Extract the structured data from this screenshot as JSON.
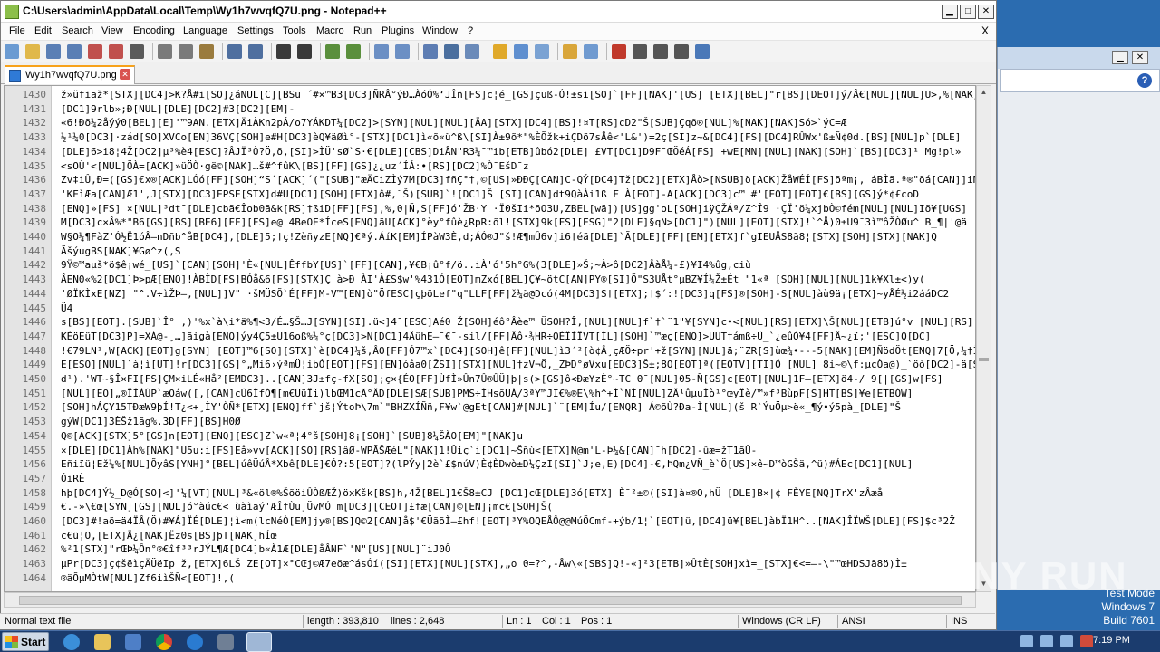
{
  "window": {
    "title": "C:\\Users\\admin\\AppData\\Local\\Temp\\Wy1h7wvqfQ7U.png - Notepad++",
    "close_doc": "X"
  },
  "menu": [
    "File",
    "Edit",
    "Search",
    "View",
    "Encoding",
    "Language",
    "Settings",
    "Tools",
    "Macro",
    "Run",
    "Plugins",
    "Window",
    "?"
  ],
  "tab": {
    "label": "Wy1h7wvqfQ7U.png"
  },
  "editor": {
    "line_numbers": [
      "1430",
      "1431",
      "1432",
      "1433",
      "1434",
      "1435",
      "1436",
      "1437",
      "1438",
      "1439",
      "1440",
      "1441",
      "1442",
      "1443",
      "1444",
      "1445",
      "1446",
      "1447",
      "1448",
      "1449",
      "1450",
      "1451",
      "1452",
      "1453",
      "1454",
      "1455",
      "1456",
      "1457",
      "1458",
      "1459",
      "1460",
      "1461",
      "1462",
      "1463",
      "1464"
    ],
    "lines": [
      "ž»ŭfiaž*[STX][DC4]>K?Å#i[SO]¿áNUL[C][BSu ´#×™B3[DC3]ÑRÂ°ýÐ…ÀóÓ%‘JÎñ[FS]c¦é_[GS]çuß-Ó!±si[SO]`[FF][NAK]'[US]  [ETX][BEL]\"r[BS][DEOT]ý/Â€[NUL][NUL]U>,%[NAK]",
      "[DC1]9rlb»;Ð[NUL][DLE][DC2]#3[DC2][EM]-",
      "«6!Ðõ¼2åýý0[BEL][E]'™9AN.[ETX]ÄiÀKn2pÁ/o7YÁKDT¼[DC2]>[SYN][NUL][NUL][ÄA][STX][DC4][BS]!¤T[RS]cD2\"Š[SUB]Çqð®[NUL]%[NAK][NAK]Só>`ýC=Æ",
      "½¹¼0[DC3]·zád[SO]XVCo[EN]36VÇ[SOH]e#H[DC3]èQ¥äØì°-[STX][DC1]ì«õ«ü^ß\\[SI]À±9õ*\"%ÈÕžk+iÇDõ7sÅê<'L&')=2ç[SI]z~&[DC4][FS][DC4]RÛWx'ß±Ñ¢0d.[BS][NUL]p`[DLE]",
      "[DLE]6>i8¦4Ž[DC2]µ³%è4[ESC]?ÂJÏ³Ò?Ö,õ,[SI]>ÌÜ'sØ`S·€[DLE][CBS]DiÅN\"R3¼¯™ib[ETB]ûbó2[DLE] £VT[DC1]D9F¯ŒÖéÁ[FS] +wE[MN][NUL][NAK][SOH]`[BS][DC3]¹ Mg!pl»",
      "<sOÙ'<[NUL]ÖÀ=[ACK]»üÖÒ·gë©[NAK]…š#^fûK\\[BS][FF][GS]¿¿uz´ÍÁ:•[RS][DC2]%Ò¯EšD¯z",
      "Zv‡iÛ,Ð=([GS]€x®[ACK]LÓó[FF][SOH]“S´[ACK]´(\"[SUB]\"æÄCiZÌý7M[DC3]fñÇ°†,©[US]»ÐÐÇ[CAN]C-QÝ[DC4]Tž[DC2][ETX]Åò>[NSUB]ö[ACK]ŽåWÉÍ[FS]õªm¡, áBÌã.ª®\"õá[CAN]]iN",
      "'KEìÆa[CAN]Æ1',J[STX][DC3]EPSE[STX]d#U[DC1][SOH][ETX]ô#,¨Š)[SUB]`![DC1]Š [SI][CAN]dt9QàÀi1ß F À[EOT]-A[ACK][DC3]c™ #'[EOT][EOT]€[BS][GS]ý*¢£coD",
      "[ENQ]»[FS] ×[NUL]³dt¯[DLE]cbã€Îob0ã&k[RS]†ßiD[FF][FS],%,0|Ñ,S[FF]ó'ŽB·Y ·Ï0šIi*õO3U,ZBEL[wã])[US]gg'oL[SOH]iÿÇŽÁª/Z^Î9 ·ÇÏ'ö¼xjbÒ©fém[NUL][NUL]Iõ¥[UGS]",
      "M[DC3]c×Â%*\"B6[GS][BS][BE6][FF][FS]e@ 4BeOE*ÍceS[ENQ]ãU[ACK]°èy°fûè¿RpR:õl![STX]9k[FS][ESG]\"2[DLE]§qN>[DC1]\")[NUL][EOT][STX]!`^Å)0±U9¯3ì™ôŽÒØu^ B_¶|'@ä",
      "W§O¼¶FàZ'Ó½Ë1óÂ–nDñb^åB[DC4],[DLE]5;†ç!ZèñyzE[NQ]€ªý.ÁíK[EM]ÍPàW3È,d;ÁÓ®J\"š!Æ¶mÛ6v]i6†éã[DLE]`Ã[DLE][FF][EM][ETX]f`gIEUÅS8ã8¦[STX][SOH][STX][NAK]Q",
      "ÃšýugBS[NAK]¥Gø^z(,S",
      "    9Ÿ©™aµš*ö$ê¡wé_[US]`[CAN][SOH]'È«[NUL]ÊffbY[US]`[FF][CAN],¥€B¡û°f/ö..iÀ'ó'5h°G%(3[DLE]»Š;~À>ô[DC2]ÂàÅ¼-£)¥I4%ûg,ciù",
      "ÂEN0«%2[DC1]Þ>pÆ[ENQ]!ÀBÌD[FS]BÓå&6[FS][STX]Ç à>Ð  ÀI'À£S$w'%431Ó[EOT]mZxó[BEL]Ç¥~ötC[AN]PY®[SI]Õ\"S3UÅt°µBZ¥Í¼Ž±Ét \"1«ª [SOH][NUL][NUL]1k¥Xl±<)y(",
      "'ØÏKÌxE[NZ] \"^.V÷ìŽÞ—,[NUL]]V\" ·šMÜSÕ`É[FF]M-V™[EN]ò\"ÖfESC]çþõLef\"q\"LLF[FF]ž¼ä@Dcó(4M[DC3]S†[ETX];†$´:![DC3]q[FS]®[SOH]-S[NUL]àù9ä¡[ETX]~yÅÉ½i2ááDC2",
      "Ü4",
      "s[BS][EOT].[SUB]`Î° ,)'%x`à\\i*ä%¶<3/É…§Š…J[SYN][SI].ü<]4¯[ESC]Aé0 Ž[SOH]éô°Âèe™ ÜSOH?Î,[NUL][NUL]f`†`¨1\"¥[SYN]c•<[NUL][RS][ETX]\\Š[NUL][ETB]ú°v  [NUL][RS]",
      "KÈöÈüT[DC3]P]=XÁ@-¸…]ãigà[ENQ]ýy4Ç5±Ü16oß%¼°ç[DC3]>N[DC1]4ÄühÈ—¯€¯-sil/[FF]Äô·¾HR÷ÖÈÎÌÏVT[ÍL][SOH]`™æç[ENQ]>UUT†ámß÷Û_`¿eûÒ¥4[FF]Ä~¿ï;'[ESC]Q[DC]",
      "!€79LN¹,W[ACK][EOT]g[SYN] [EOT]™6[SO][STX]`è[DC4]¼š,ÂO[FF]Ó7™x`[DC4][SOH]ê[FF][NUL]ì3´²[ò¢Â¸çÆÖ÷pr'+ž[SYN][NUL]ä;¨ZR[S]ùœ¾•---5[NAK][EM]ÑödÖt[ENQ]7[Ö,¼†Ì^¹-Óþ",
      "E[ESO][NUL]`à¦ì[UT]!r[DC3][GS]°„Mi6›ýªmÜ¦ibÓ[EOT][FS][EN]óåa0[ŽSI][STX][NUL]†zV¬Ö,_ZÞD°øVxu[EDC3]Š±;8O[EOT]ª([EOTV][TI]Ó [NUL] 8i~©\\f:µcÒa@)_`öò[DC2]-ä[SI]",
      "d¹).'WT~§Î×FI[FS]ÇM×iLÉ«Hå²[EMDC3]..[CAN]3J±fç-fX[SO];ç×{ÉO[FF]ÙfÌ»Ûn7Û®ÛÜ]þ|s(>[GS]ô<ÐæYzÈ°~TC 0¯[NUL]05-Ñ[GS]c[EOT][NUL]1F—[ETX]ö4-/ 9[|[GS]w[FS]",
      "[NUL][EO]„®ÎÌÀÚP`æOáw([,[CAN]cÙ6ÍfÓ¶[m€ÜüÏi)lbŒM1cÃ°ÂD[DLE]SÆ[SUB]PMS÷ÍHsõUÁ/3ªY™JI€%®E\\%h^+Í`NÍ[NUL]ZÂ¹ûµuÍò¹°œyÎè/™»f³BùpF[S]HT[BS]¥e[ETBÓW]",
      "[SOH]hÁÇY15TÐæW9þÍ!T¿<+¸ÌY'ÒÑ*[ETX][ENQ]ff`jš¦ÝtoÞ\\7m`\"BHZXÍÑñ,F¥w`@gEt[CAN]#[NUL]`¨[EM]Íu/[ENQR]  Á©õÙ?Ða-Ì[NUL](š R`ÝuÖµ>ë«_¶ý•ý5pà_[DLE]\"Š",
      "gýW[DC1]3ÈŠž1ãg%.3D[FF][BS]H0Ø",
      "Q©[ACK][STX]5°[GS]n[EOT][ENQ][ESC]Z`w«ª¦4°š[SOH]8¡[SOH]`[SUB]8¼ŠÀO[EM]\"[NAK]u",
      "×[DLE][DC1]Àh%[NAK]\"U5u:i[FS]Eå»vv[ACK][SO][RS]âØ-WPÃŠÆéL\"[NAK]1!Ûiç`i[DC1]~Šñù<[ETX]N@m'L-Þ¼&[CAN]¯h[DC2]-ûæ=žT1ãÛ-",
      "Eñiïü¦Ež¼%[NUL]ÕyâS[YNH]°[BEL]úêÜúÂ*Xbê[DLE]€Ó?:5[EOT]?(lPÝy|2è`£$núV)È¢ÈDwò±D¼ÇzI[SI]`J;e,E)[DC4]-€,ÞQm¿VÑ_è`Ö[US]×ê~D™òGŠä,^ü)#ÁEc[DC1][NUL]",
      "ÓiRÈ",
      "hþ[DC4]Ý½_D@Ó[SO]<]'¼[VT][NUL]³&«öl®%ŠõöiÛÒßÆŽ)öxKšk[BS]h,4Ž[BEL]1€Š8±CJ    [DC1]cŒ[DLE]3ó[ETX] È¯²±©([SI]à¤®O,hÜ [DLE]B×|¢   FÈYE[NQ]TrX'zÂæå",
      "€.-»\\€œ[SYN][GS][NUL]ó°àúc€<¯ùàìaý'ÆÎfÙu]ÜvMÓ¨m[DC3][CEOT]£fæ[CAN]©[EN]¡mc€[SOH]Š(",
      "[DC3]#!aõ=ä4ÏÂ(Ö)#¥Á]ÏÉ[DLE]¦ì<m(lcNéÒ[EM]jy®[BS]Q©2[CAN]å$'€ÜãõÌ—£hf![EOT]³Y%OQEÅÔ@@MúÕCmf-+ýb/1¦`[EOT]ü,[DC4]ü¥[BEL]àbÏ1H^..[NAK]ÎÏWŠ[DLE][FS]$c³2Ž",
      "c€ü¦O,[ETX]Ä¿[NAK]Ëz0s[BS]þT[NAK]hÍœ",
      "%²1[STX]\"rŒÞ¼Ôn°®€îf³³rJÝL¶Æ[DC4]b«À1Æ[DLE]åÂNF`'N\"[US][NUL]¨iJ0Ô",
      "µPr[DC3]ç¢šëìçÄÜëIp ž,[ETX]6LŠ ZE[OT]×°CŒj©Æ7eöæ^ásÓí([SI][ETX][NUL][STX],„o 0=?^,-Åw\\«[SBS]Q!-«]²3[ETB]»ÛtÈ[SOH]xì=_[STX]€<=—-\\\"™œHDSJã8ö)Ì±",
      "®äÕµMÒtW[NUL]Zf6iìŠÑ<[EOT]!,("
    ]
  },
  "status": {
    "file_type": "Normal text file",
    "length": "length : 393,810",
    "lines": "lines : 2,648",
    "ln": "Ln : 1",
    "col": "Col : 1",
    "pos": "Pos : 1",
    "eol": "Windows (CR LF)",
    "encoding": "ANSI",
    "mode": "INS"
  },
  "os": {
    "start": "Start",
    "clock": "7:19 PM",
    "test_mode": "Test Mode",
    "windows_version": "Windows 7",
    "build": "Build 7601",
    "watermark": "ANY RUN"
  },
  "toolbar_icons": [
    "new-file-icon",
    "open-file-icon",
    "save-icon",
    "save-all-icon",
    "close-icon",
    "close-all-icon",
    "print-icon",
    "cut-icon",
    "copy-icon",
    "paste-icon",
    "undo-icon",
    "redo-icon",
    "find-icon",
    "replace-icon",
    "zoom-in-icon",
    "zoom-out-icon",
    "sync-v-icon",
    "sync-h-icon",
    "wrap-icon",
    "all-chars-icon",
    "indent-guide-icon",
    "lang-icon",
    "map-icon",
    "func-list-icon",
    "folder-icon",
    "monitor-icon",
    "record-icon",
    "stop-icon",
    "play-icon",
    "play-multi-icon",
    "save-macro-icon"
  ],
  "colors": {
    "accent": "#f7a21b",
    "desktop": "#2b6cb0",
    "taskbar": "#1b3c6e"
  }
}
